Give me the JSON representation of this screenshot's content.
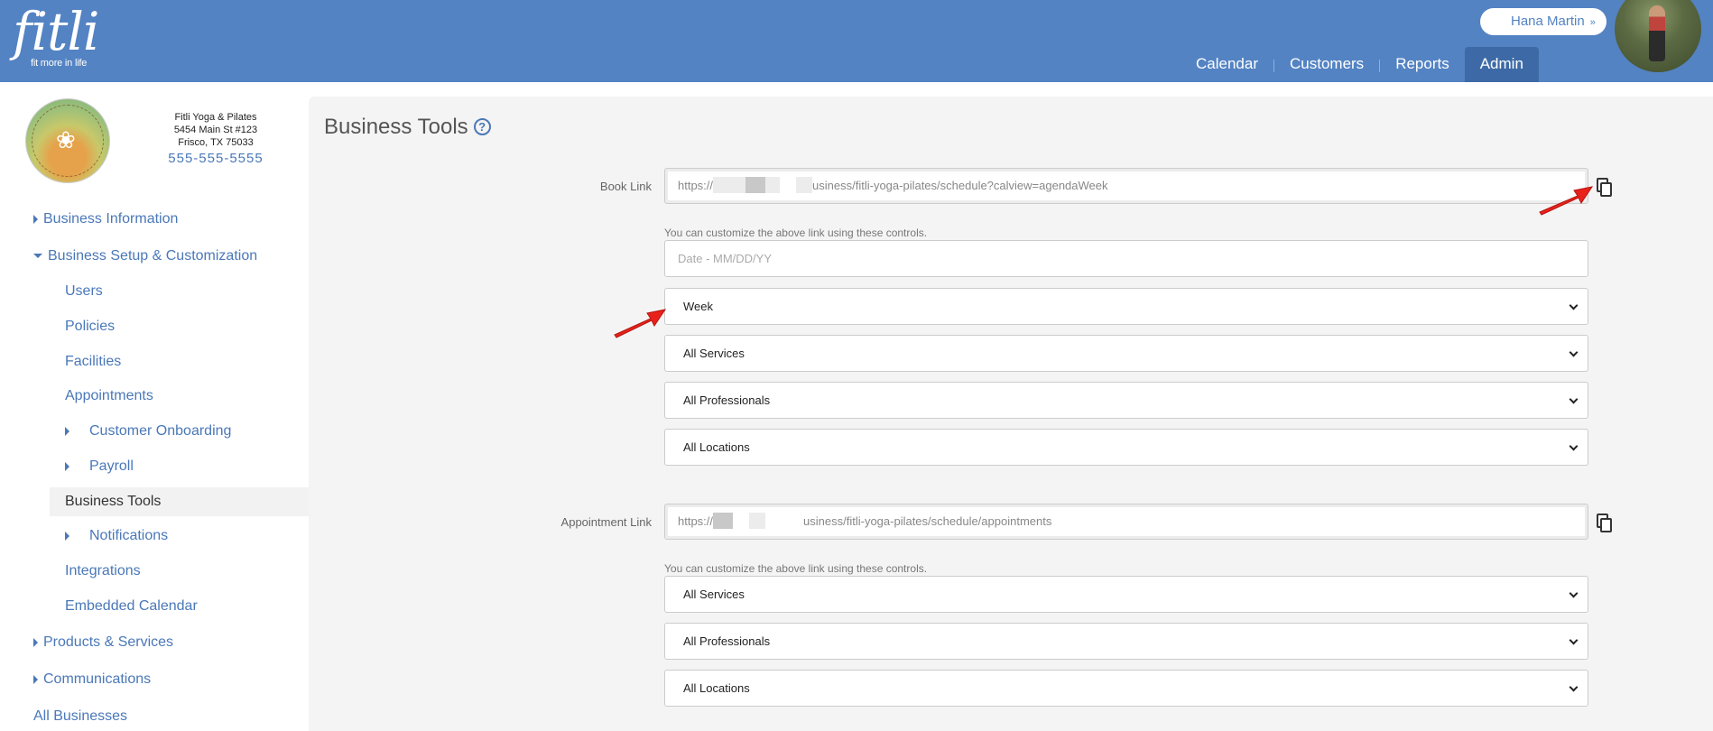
{
  "brand": {
    "name": "fitli",
    "tagline": "fit more in life"
  },
  "user": {
    "name": "Hana Martin",
    "chevron": "»"
  },
  "nav": {
    "items": [
      "Calendar",
      "Customers",
      "Reports",
      "Admin"
    ],
    "active": "Admin"
  },
  "business": {
    "name": "Fitli Yoga & Pilates",
    "address1": "5454 Main St #123",
    "address2": "Frisco, TX 75033",
    "phone": "555-555-5555"
  },
  "sidebar": {
    "business_information": "Business Information",
    "business_setup": "Business Setup & Customization",
    "users": "Users",
    "policies": "Policies",
    "facilities": "Facilities",
    "appointments": "Appointments",
    "customer_onboarding": "Customer Onboarding",
    "payroll": "Payroll",
    "business_tools": "Business Tools",
    "notifications": "Notifications",
    "integrations": "Integrations",
    "embedded_calendar": "Embedded Calendar",
    "products_services": "Products & Services",
    "communications": "Communications",
    "all_businesses": "All Businesses"
  },
  "main": {
    "title": "Business Tools",
    "help_icon": "?",
    "book_link": {
      "label": "Book Link",
      "url_start": "https://",
      "url_end": "usiness/fitli-yoga-pilates/schedule?calview=agendaWeek",
      "hint": "You can customize the above link using these controls.",
      "date_placeholder": "Date - MM/DD/YY",
      "view": "Week",
      "services": "All Services",
      "professionals": "All Professionals",
      "locations": "All Locations"
    },
    "appointment_link": {
      "label": "Appointment Link",
      "url_start": "https://",
      "url_end": "usiness/fitli-yoga-pilates/schedule/appointments",
      "hint": "You can customize the above link using these controls.",
      "services": "All Services",
      "professionals": "All Professionals",
      "locations": "All Locations"
    }
  },
  "colors": {
    "header": "#5383c3",
    "active_nav": "#3d6aa6",
    "link": "#4a78b8",
    "arrow": "#e8221b"
  }
}
